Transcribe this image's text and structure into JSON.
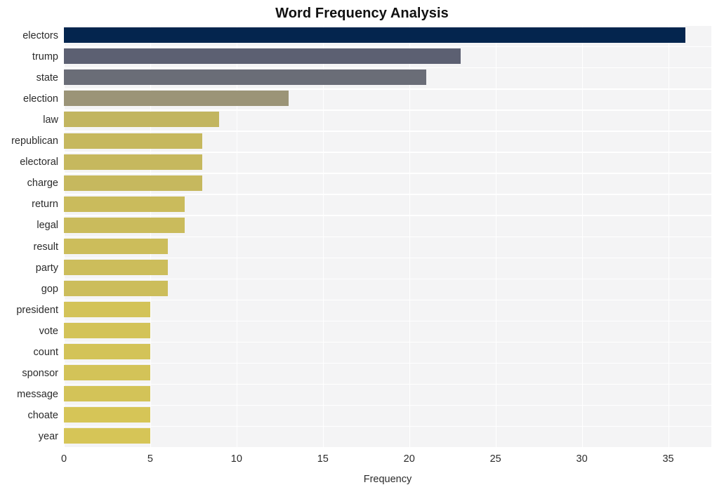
{
  "chart_data": {
    "type": "bar",
    "orientation": "horizontal",
    "title": "Word Frequency Analysis",
    "xlabel": "Frequency",
    "ylabel": "",
    "xlim": [
      0,
      37.5
    ],
    "xticks": [
      0,
      5,
      10,
      15,
      20,
      25,
      30,
      35
    ],
    "xtick_labels": [
      "0",
      "5",
      "10",
      "15",
      "20",
      "25",
      "30",
      "35"
    ],
    "grid": true,
    "legend": null,
    "categories": [
      "electors",
      "trump",
      "state",
      "election",
      "law",
      "republican",
      "electoral",
      "charge",
      "return",
      "legal",
      "result",
      "party",
      "gop",
      "president",
      "vote",
      "count",
      "sponsor",
      "message",
      "choate",
      "year"
    ],
    "values": [
      36,
      23,
      21,
      13,
      9,
      8,
      8,
      8,
      7,
      7,
      6,
      6,
      6,
      5,
      5,
      5,
      5,
      5,
      5,
      5
    ],
    "bar_colors": [
      "#04254e",
      "#5c6072",
      "#6a6d77",
      "#9b9477",
      "#c2b55f",
      "#c6b85e",
      "#c6b85e",
      "#c6b85e",
      "#cabb5c",
      "#cabb5c",
      "#ccbd5b",
      "#ccbd5b",
      "#ccbd5b",
      "#d3c358",
      "#d3c358",
      "#d3c358",
      "#d3c358",
      "#d3c358",
      "#d6c557",
      "#d6c557"
    ],
    "plot_background": "#f4f4f5",
    "gridline_color": "#ffffff",
    "title_color": "#111111",
    "tick_color": "#2b2b2b"
  }
}
